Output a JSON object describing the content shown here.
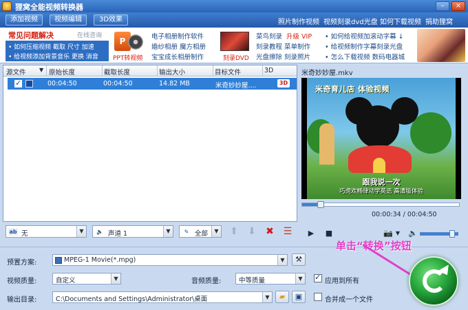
{
  "window": {
    "title": "狸窝全能视频转换器"
  },
  "menu": {
    "tabs": [
      "添加视频",
      "视频编辑",
      "3D效果"
    ],
    "links": [
      "照片制作视频",
      "视频刻录dvd光盘",
      "如何下载视频",
      "捐助狸窝"
    ]
  },
  "ads": {
    "faq_title": "常见问题解决",
    "online_consult": "在线咨询",
    "faq_line1": "• 如何压缩视频  截取  尺寸  加速",
    "faq_line2": "• 给视频添加背景音乐  更换  消音",
    "ppt_label": "PPT转视频",
    "col1": [
      "电子相册制作软件",
      "婚纱相册  魔方相册",
      "宝宝成长相册制作"
    ],
    "dvd_label": "刻录DVD",
    "col2_line1_a": "菜鸟刻录",
    "col2_line1_b": "升级 VIP",
    "col2": [
      "刻录教程  菜单制作",
      "光盘擦除  刻录照片"
    ],
    "col3": [
      "• 如何给视频加滚动字幕 ↓",
      "• 给视频制作字幕刻录光盘",
      "• 怎么下载视频  数码电器城"
    ]
  },
  "filelist": {
    "columns": [
      "源文件",
      "原始长度",
      "截取长度",
      "输出大小",
      "目标文件",
      "3D"
    ],
    "rows": [
      {
        "orig": "00:04:50",
        "cut": "00:04:50",
        "size": "14.82 MB",
        "target": "米奇妙妙屋....",
        "badge": "3D"
      }
    ]
  },
  "listbar": {
    "subtitle": "无",
    "audio": "声道 1",
    "scope": "全部"
  },
  "preview": {
    "filename": "米奇妙妙屋.mkv",
    "sign_text": "米奇育儿店 体验视频",
    "subtitle_main": "跟我说一次",
    "subtitle_sub": "巧虎欢畅律动学英语 高清版体验",
    "timecode": "00:00:34 / 00:04:50",
    "progress": 0.12,
    "volume": 0.85
  },
  "settings": {
    "preset_label": "预置方案:",
    "preset_value": "MPEG-1 Movie(*.mpg)",
    "video_quality_label": "视频质量:",
    "video_quality_value": "自定义",
    "audio_quality_label": "音频质量:",
    "audio_quality_value": "中等质量",
    "apply_all_label": "应用到所有",
    "output_label": "输出目录:",
    "output_value": "C:\\Documents and Settings\\Administrator\\桌面",
    "merge_label": "合并成一个文件",
    "hint": "单击“转换”按钮"
  },
  "colors": {
    "accent": "#2f7fd8",
    "hint": "#e040c8",
    "convert": "#25a43a"
  }
}
